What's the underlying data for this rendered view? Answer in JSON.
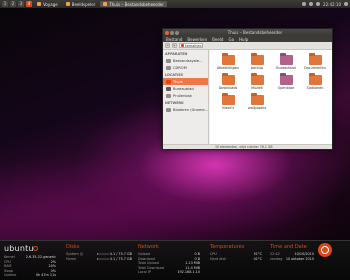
{
  "top_panel": {
    "workspaces": [
      "1",
      "2",
      "3",
      "4"
    ],
    "active_workspace": "4",
    "tasks": [
      {
        "label": "Voyage",
        "current": false
      },
      {
        "label": "Beeldspeler",
        "current": false
      },
      {
        "label": "Thuis – Bestandsbeheerder",
        "current": true
      }
    ],
    "clock": "22:42:10"
  },
  "window": {
    "title": "Thuis – Bestandsbeheerder",
    "menu": [
      "Bestand",
      "Bewerken",
      "Beeld",
      "Ga",
      "Hulp"
    ],
    "path": "kemalheo",
    "sidebar": {
      "sections": [
        {
          "heading": "APPARATEN",
          "items": [
            {
              "label": "Bestandssyste...",
              "icon": "drive-icon"
            },
            {
              "label": "CDROM",
              "icon": "cdrom-icon"
            }
          ]
        },
        {
          "heading": "LOCATIES",
          "items": [
            {
              "label": "Thuis",
              "icon": "home-icon",
              "selected": true
            },
            {
              "label": "Bureaublad",
              "icon": "desktop-icon"
            },
            {
              "label": "Prullenbak",
              "icon": "trash-icon"
            }
          ]
        },
        {
          "heading": "NETWERK",
          "items": [
            {
              "label": "Bladeren (Gnome...",
              "icon": "network-icon"
            }
          ]
        }
      ]
    },
    "files": [
      {
        "name": "Afbeeldingen",
        "alt": false
      },
      {
        "name": "backup",
        "alt": false
      },
      {
        "name": "Bureaublad",
        "alt": true
      },
      {
        "name": "Documenten",
        "alt": false
      },
      {
        "name": "Downloads",
        "alt": false
      },
      {
        "name": "Muziek",
        "alt": false
      },
      {
        "name": "Openbaar",
        "alt": true
      },
      {
        "name": "Sjablonen",
        "alt": false
      },
      {
        "name": "Video's",
        "alt": false
      },
      {
        "name": "wallpapers",
        "alt": false
      }
    ],
    "status": "10 elementen, vrije ruimte: 78,1 GB"
  },
  "conky": {
    "brand": "ubuntu",
    "system": {
      "heading": "Ubuntu",
      "rows": [
        {
          "k": "Kernel",
          "v": "2.6.35-22-generic"
        },
        {
          "k": "CPU",
          "v": "2%"
        },
        {
          "k": "RAM",
          "v": "24%"
        },
        {
          "k": "Swap",
          "v": "0%"
        },
        {
          "k": "Uptime",
          "v": "0h 47m 11s"
        }
      ]
    },
    "disks": {
      "heading": "Disks",
      "rows": [
        {
          "k": "System (/)",
          "v": "4.1 / 75.7 GB",
          "fill": 0.05
        },
        {
          "k": "Home",
          "v": "4.1 / 75.7 GB",
          "fill": 0.05
        }
      ]
    },
    "network": {
      "heading": "Network",
      "rows": [
        {
          "k": "Upload",
          "v": "0 B"
        },
        {
          "k": "Download",
          "v": "0 B"
        },
        {
          "k": "Total Upload",
          "v": "1.13 MiB"
        },
        {
          "k": "Total Download",
          "v": "11.4 MiB"
        },
        {
          "k": "Local IP",
          "v": "192.168.1.10"
        },
        {
          "k": "Public IP",
          "v": ""
        }
      ]
    },
    "temperatures": {
      "heading": "Temperatures",
      "rows": [
        {
          "k": "CPU",
          "v": "51°C"
        },
        {
          "k": "Hard disk",
          "v": "41°C"
        }
      ]
    },
    "time": {
      "heading": "Time and Date",
      "rows": [
        {
          "k": "22:42",
          "v": "10/10/2010"
        },
        {
          "k": "zondag",
          "v": "10 oktober 2010"
        }
      ]
    }
  }
}
